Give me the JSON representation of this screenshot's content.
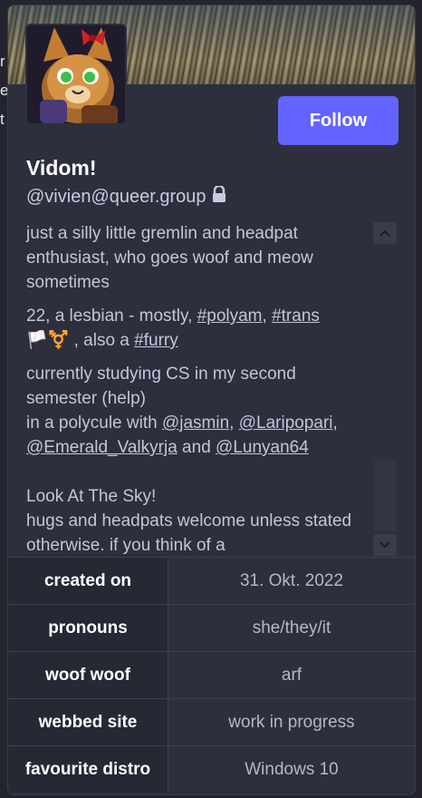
{
  "profile": {
    "display_name": "Vidom!",
    "handle": "@vivien@queer.group",
    "follow_label": "Follow",
    "bio": {
      "p1": "just a silly little gremlin and headpat enthusiast, who goes woof and meow sometimes",
      "p2_prefix": "22, a lesbian - mostly, ",
      "tag_polyam": "#polyam",
      "tag_trans": "#trans",
      "p2_emoji": "🏳️⚧️",
      "p2_mid": " , also a ",
      "tag_furry": "#furry",
      "p3_line1": "currently studying CS in my second semester (help)",
      "p3_line2_prefix": "in a polycule with ",
      "mention_jasmin": "@jasmin",
      "mention_laripopari": "@Laripopari",
      "mention_emerald": "@Emerald_Valkyrja",
      "p3_and": " and ",
      "mention_lunyan": "@Lunyan64",
      "p4_line1": "Look At The Sky!",
      "p4_line2": "hugs and headpats welcome unless stated otherwise. if you think of a"
    },
    "fields": [
      {
        "key": "created on",
        "value": "31. Okt. 2022"
      },
      {
        "key": "pronouns",
        "value": "she/they/it"
      },
      {
        "key": "woof woof",
        "value": "arf"
      },
      {
        "key": "webbed site",
        "value": "work in progress"
      },
      {
        "key": "favourite distro",
        "value": "Windows 10"
      }
    ]
  },
  "icons": {
    "lock": "lock-icon",
    "scroll_up": "chevron-up-icon",
    "scroll_down": "chevron-down-icon"
  },
  "colors": {
    "accent": "#6364ff",
    "card_bg": "#2d2f3d",
    "field_key_bg": "#262833"
  }
}
